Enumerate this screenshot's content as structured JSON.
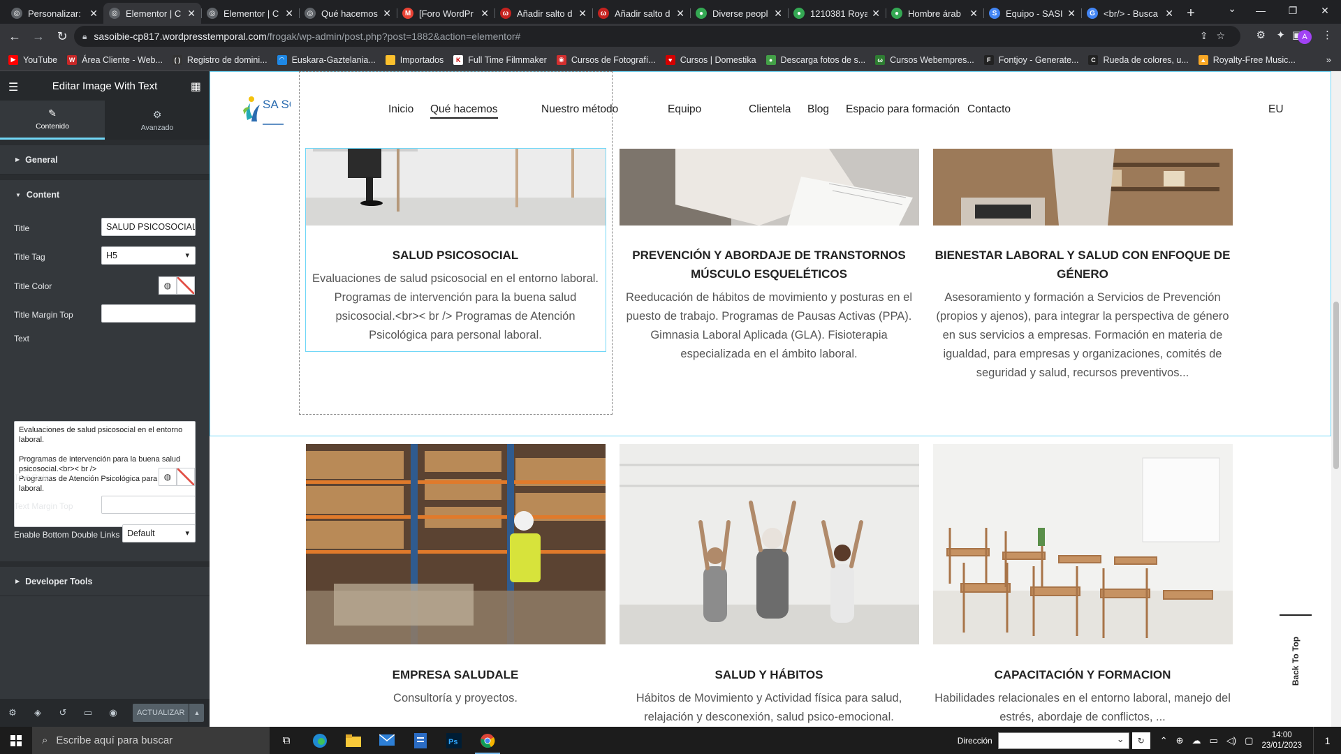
{
  "browser": {
    "tabs": [
      {
        "label": "Personalizar:",
        "color": "#5f6368",
        "glyph": "◎"
      },
      {
        "label": "Elementor | C",
        "color": "#5f6368",
        "glyph": "◎",
        "active": true
      },
      {
        "label": "Elementor | C",
        "color": "#5f6368",
        "glyph": "◎"
      },
      {
        "label": "Qué hacemos",
        "color": "#5f6368",
        "glyph": "◎"
      },
      {
        "label": "[Foro WordPr",
        "color": "#ea4335",
        "glyph": "M"
      },
      {
        "label": "Añadir salto d",
        "color": "#c5221f",
        "glyph": "ω"
      },
      {
        "label": "Añadir salto d",
        "color": "#c5221f",
        "glyph": "ω"
      },
      {
        "label": "Diverse peopl",
        "color": "#34a853",
        "glyph": "●"
      },
      {
        "label": "1210381 Roya",
        "color": "#34a853",
        "glyph": "●"
      },
      {
        "label": "Hombre árab",
        "color": "#34a853",
        "glyph": "●"
      },
      {
        "label": "Equipo - SASI",
        "color": "#4285f4",
        "glyph": "S"
      },
      {
        "label": "<br/> - Busca",
        "color": "#4285f4",
        "glyph": "G"
      }
    ],
    "new_tab": "+",
    "url_host": "sasoibie-cp817.wordpresstemporal.com",
    "url_path": "/frogak/wp-admin/post.php?post=1882&action=elementor#",
    "profile_initial": "A",
    "bookmarks": [
      {
        "label": "YouTube",
        "color": "#ff0000",
        "glyph": "▶"
      },
      {
        "label": "Área Cliente - Web...",
        "color": "#c62828",
        "glyph": "W"
      },
      {
        "label": "Registro de domini...",
        "color": "#333333",
        "glyph": "( )"
      },
      {
        "label": "Euskara-Gaztelania...",
        "color": "#1e88e5",
        "glyph": "◠"
      },
      {
        "label": "Importados",
        "color": "#fbc02d",
        "glyph": ""
      },
      {
        "label": "Full Time Filmmaker",
        "color": "#ffffff",
        "glyph": "K"
      },
      {
        "label": "Cursos de Fotografí...",
        "color": "#d32f2f",
        "glyph": "◉"
      },
      {
        "label": "Cursos | Domestika",
        "color": "#d50000",
        "glyph": "♥"
      },
      {
        "label": "Descarga fotos de s...",
        "color": "#43a047",
        "glyph": "●"
      },
      {
        "label": "Cursos Webempres...",
        "color": "#2e7d32",
        "glyph": "ω"
      },
      {
        "label": "Fontjoy - Generate...",
        "color": "#222222",
        "glyph": "F"
      },
      {
        "label": "Rueda de colores, u...",
        "color": "#222222",
        "glyph": "C"
      },
      {
        "label": "Royalty-Free Music...",
        "color": "#f9a825",
        "glyph": "▲"
      }
    ],
    "bookmarks_more": "»"
  },
  "panel": {
    "header_title": "Editar Image With Text",
    "tabs": {
      "content": "Contenido",
      "advanced": "Avanzado"
    },
    "sections": {
      "general": "General",
      "content": "Content",
      "developer": "Developer Tools"
    },
    "controls": {
      "title_label": "Title",
      "title_value": "SALUD PSICOSOCIAL",
      "title_tag_label": "Title Tag",
      "title_tag_value": "H5",
      "title_color_label": "Title Color",
      "title_margin_label": "Title Margin Top",
      "text_label": "Text",
      "text_value": "Evaluaciones de salud psicosocial en el entorno laboral.\n\nProgramas de intervención para la buena salud psicosocial.<br>< br />\nProgramas de Atención Psicológica para personal laboral.",
      "text_color_label": "Text Color",
      "text_margin_label": "Text Margin Top",
      "bottom_links_label": "Enable Bottom Double Links",
      "bottom_links_value": "Default"
    },
    "footer": {
      "update_label": "ACTUALIZAR"
    }
  },
  "site": {
    "logo_text": "SA SOI",
    "nav": [
      "Inicio",
      "Qué hacemos",
      "Nuestro método",
      "Equipo",
      "Clientela",
      "Blog",
      "Espacio para formación",
      "Contacto"
    ],
    "nav_current_index": 1,
    "lang": "EU",
    "cards_row1": [
      {
        "title": "SALUD PSICOSOCIAL",
        "text": "Evaluaciones de salud psicosocial en el entorno laboral. Programas de intervención para la buena salud psicosocial.<br>< br /> Programas de Atención Psicológica para personal laboral."
      },
      {
        "title": "PREVENCIÓN Y ABORDAJE DE TRANSTORNOS MÚSCULO ESQUELÉTICOS",
        "text": "Reeducación de hábitos de movimiento y posturas en el puesto de trabajo. Programas de Pausas Activas (PPA). Gimnasia Laboral Aplicada (GLA). Fisioterapia especializada en el ámbito laboral."
      },
      {
        "title": "BIENESTAR LABORAL Y SALUD CON ENFOQUE DE GÉNERO",
        "text": "Asesoramiento y formación a Servicios de Prevención (propios y ajenos), para integrar la perspectiva de género en sus servicios a empresas. Formación en materia de igualdad, para empresas y organizaciones, comités de seguridad y salud, recursos preventivos..."
      }
    ],
    "cards_row2": [
      {
        "title": "EMPRESA SALUDALE",
        "text": "Consultoría y proyectos."
      },
      {
        "title": "SALUD Y HÁBITOS",
        "text": "Hábitos de Movimiento y Actividad física para salud, relajación y desconexión, salud psico-emocional."
      },
      {
        "title": "CAPACITACIÓN Y FORMACION",
        "text": "Habilidades relacionales en el entorno laboral, manejo del estrés, abordaje de conflictos, ..."
      }
    ],
    "back_to_top": "Back To Top"
  },
  "taskbar": {
    "search_placeholder": "Escribe aquí para buscar",
    "direccion_label": "Dirección",
    "time": "14:00",
    "date": "23/01/2023",
    "notification_count": "1"
  }
}
